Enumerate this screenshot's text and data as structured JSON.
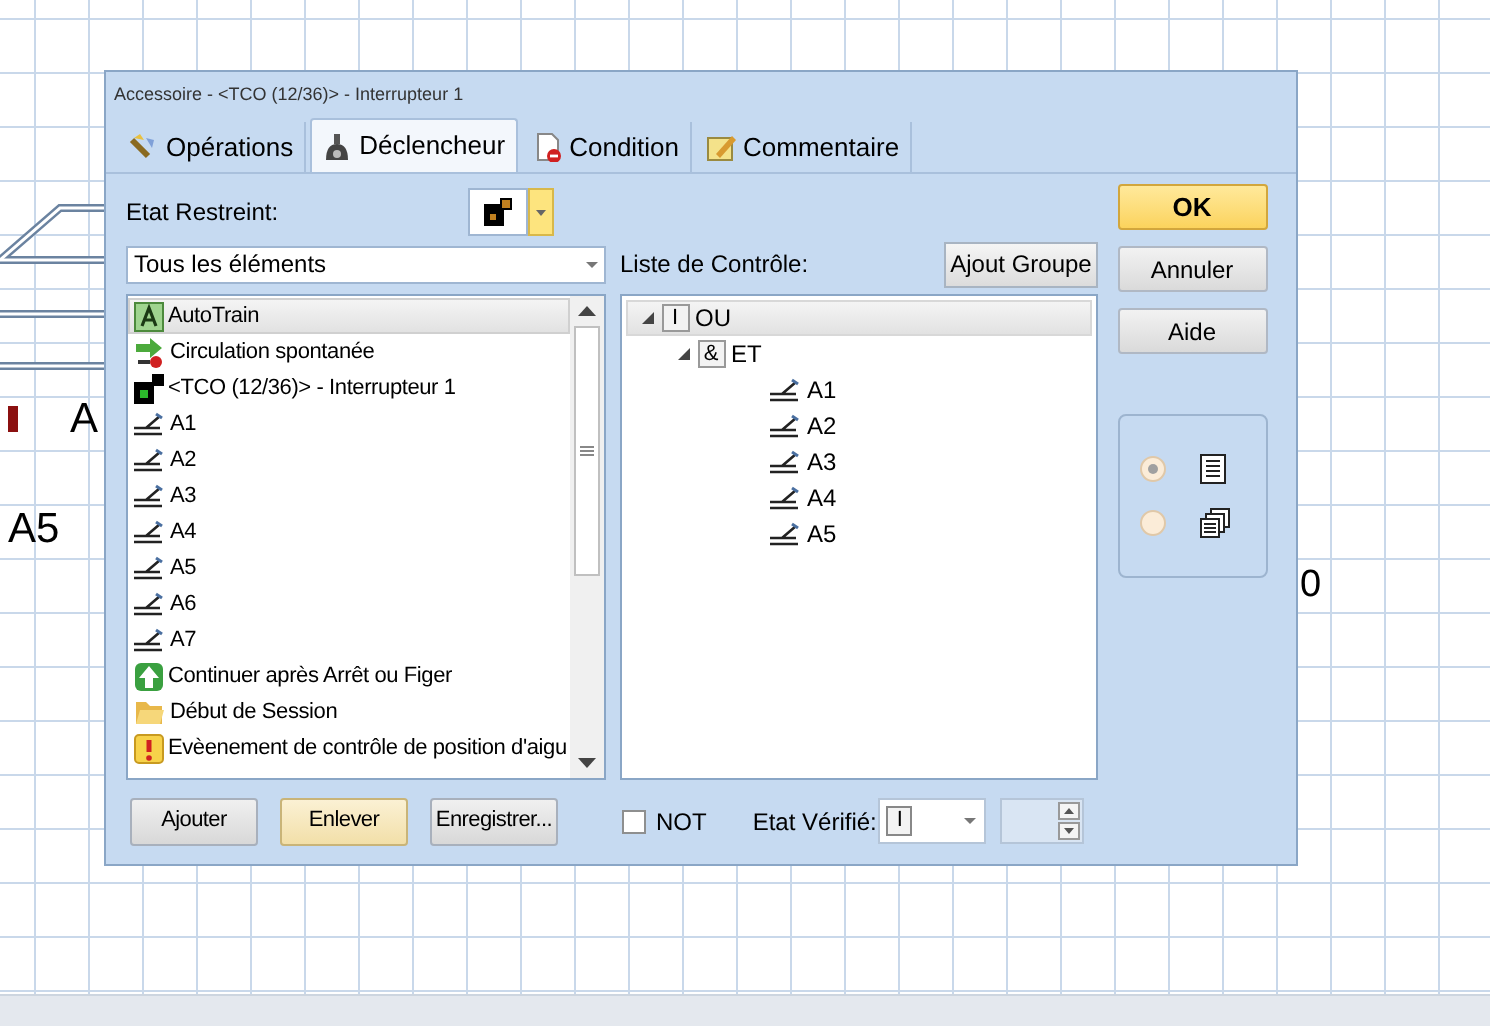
{
  "canvas": {
    "labels": [
      {
        "text": "A"
      },
      {
        "text": "A5"
      },
      {
        "text": "0"
      }
    ]
  },
  "dialog": {
    "title": "Accessoire - <TCO (12/36)> - Interrupteur 1",
    "tabs": [
      {
        "label": "Opérations",
        "kind": "operations",
        "selected": false
      },
      {
        "label": "Déclencheur",
        "kind": "trigger",
        "selected": true
      },
      {
        "label": "Condition",
        "kind": "condition",
        "selected": false
      },
      {
        "label": "Commentaire",
        "kind": "comment",
        "selected": false
      }
    ],
    "restricted_state": {
      "label": "Etat Restreint:"
    },
    "filter": {
      "value": "Tous les éléments"
    },
    "elements": [
      {
        "label": "AutoTrain",
        "kind": "text",
        "selected": true
      },
      {
        "label": "Circulation spontanée",
        "kind": "spontaneous",
        "selected": false
      },
      {
        "label": "<TCO (12/36)> - Interrupteur 1",
        "kind": "tco",
        "selected": false
      },
      {
        "label": "A1",
        "kind": "accessory",
        "selected": false
      },
      {
        "label": "A2",
        "kind": "accessory",
        "selected": false
      },
      {
        "label": "A3",
        "kind": "accessory",
        "selected": false
      },
      {
        "label": "A4",
        "kind": "accessory",
        "selected": false
      },
      {
        "label": "A5",
        "kind": "accessory",
        "selected": false
      },
      {
        "label": "A6",
        "kind": "accessory",
        "selected": false
      },
      {
        "label": "A7",
        "kind": "accessory",
        "selected": false
      },
      {
        "label": "Continuer après Arrêt ou Figer",
        "kind": "continue",
        "selected": false
      },
      {
        "label": "Début de Session",
        "kind": "session",
        "selected": false
      },
      {
        "label": "Evèenement de contrôle de position d'aigu",
        "kind": "event",
        "selected": false
      }
    ],
    "control_list": {
      "label": "Liste de Contrôle:",
      "add_group": "Ajout Groupe",
      "tree": [
        {
          "label": "OU",
          "symbol": "I",
          "expanded": true,
          "selected": true,
          "children": [
            {
              "label": "ET",
              "symbol": "&",
              "expanded": true,
              "selected": false,
              "children": [
                {
                  "label": "A1",
                  "selected": false
                },
                {
                  "label": "A2",
                  "selected": false
                },
                {
                  "label": "A3",
                  "selected": false
                },
                {
                  "label": "A4",
                  "selected": false
                },
                {
                  "label": "A5",
                  "selected": false
                }
              ]
            }
          ]
        }
      ]
    },
    "buttons": [
      {
        "label": "OK",
        "kind": "default"
      },
      {
        "label": "Annuler",
        "kind": "normal"
      },
      {
        "label": "Aide",
        "kind": "normal"
      }
    ],
    "view_options": [
      {
        "kind": "list",
        "selected": true
      },
      {
        "kind": "cascade",
        "selected": false
      }
    ],
    "actions": [
      {
        "label": "Ajouter",
        "highlighted": false
      },
      {
        "label": "Enlever",
        "highlighted": true
      },
      {
        "label": "Enregistrer...",
        "highlighted": false
      }
    ],
    "not_option": {
      "label": "NOT",
      "checked": false
    },
    "verified_state": {
      "label": "Etat Vérifié:",
      "value": "I"
    }
  }
}
